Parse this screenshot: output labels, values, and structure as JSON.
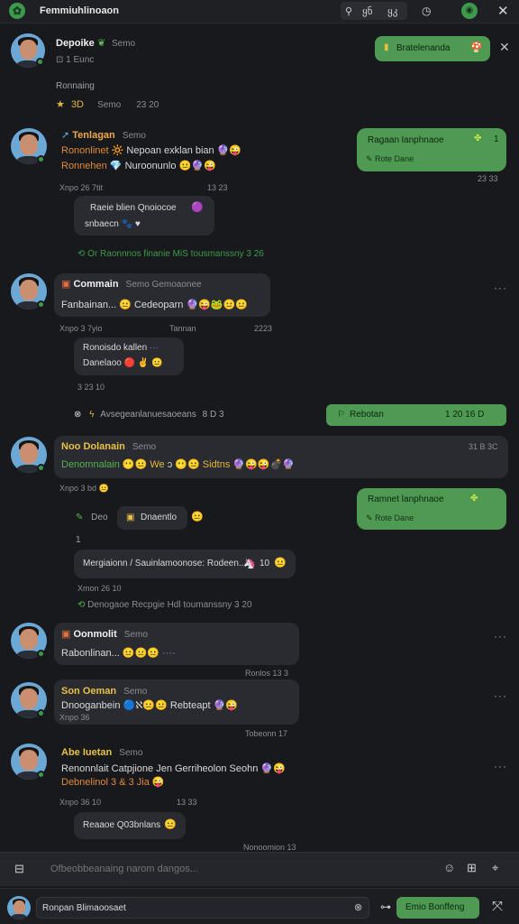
{
  "titlebar": {
    "title": "Femmiuhlinoaon",
    "control_a": "ყნ",
    "control_b": "ყკ",
    "control_c": "დ"
  },
  "contact": {
    "name": "Depoike",
    "status": "1 Eunc",
    "pinned_label": "Bratelenanda"
  },
  "section": {
    "title": "Ronnaing",
    "meta": "3D",
    "time": "23 20"
  },
  "messages": [
    {
      "sender": "Tenlagan",
      "sender_meta": "Semo",
      "line1": "Rononlinet",
      "line1b": "Nepoan exklan bian",
      "line2": "Ronnehen",
      "line2b": "Nuroonunlo",
      "meta_left": "Xnpo 26 7tit",
      "meta_right": "13 23"
    },
    {
      "reply_line1": "Raeie blien Qnoiocoe",
      "reply_line2": "snbaecn",
      "thread_link": "Or Raonnnos finanie MiS tousmanssny 3 26"
    },
    {
      "sender": "Commain",
      "sender_meta": "Semo Gemoaonee",
      "line1": "Fanbainan...",
      "line1b": "Cedeoparn",
      "meta_left": "Xnpo 3 7yio",
      "meta_center": "Tannan",
      "meta_right": "2223",
      "reply_line1": "Ronoisdo kallen",
      "reply_line2": "Danelaoo",
      "reply_time": "3 23 10"
    },
    {
      "sender": "Noo Dolanain",
      "sender_meta": "Semo",
      "line1": "Denomnalain",
      "line1b": "We",
      "line1c": "Sidtns",
      "meta_right": "31 B 3C",
      "meta_left": "Xnpo 3 bd",
      "chip": "Dnaentlo",
      "chip_lead": "Deo",
      "time_row": "1",
      "long_reply": "Mergiaionn / Sauinlamoonose: Rodeen...",
      "long_reply_tail": "10",
      "long_reply_meta": "Xmon 26 10",
      "thread_link": "Denogaoe Recpgie Hdl toumanssny 3 20"
    },
    {
      "sender": "Oonmolit",
      "sender_meta": "Semo",
      "line1": "Rabonlinan...",
      "time": "Ronlos 13 3"
    },
    {
      "sender": "Son Oeman",
      "sender_meta": "Semo",
      "line1": "Dnooganbein",
      "line1b": "Rebteapt",
      "meta_left": "Xnpo 36",
      "time": "Tobeonn 17"
    },
    {
      "sender": "Abe Iuetan",
      "sender_meta": "Semo",
      "line1": "Renonnlait",
      "line1b": "Catpjione",
      "line1c": "Jen Gerriheolon Seohn",
      "line2": "Debnelinol 3 & 3 Jia",
      "meta_left": "Xnpo 36 10",
      "meta_right": "13 33",
      "reply": "Reaaoe Q03bnlans",
      "time": "Nonoomion 13"
    }
  ],
  "outgoing": [
    {
      "title": "Ragaan lanphnaoe",
      "sub": "Rote Dane",
      "side": "1",
      "time": "23 33"
    },
    {
      "title": "Rebotan",
      "time": "1 20 16 D"
    },
    {
      "title": "Ramnet lanphnaoe",
      "sub": "Rote Dane"
    }
  ],
  "notice": {
    "text": "Avsegeanlanuesaoeans",
    "tail": "8 D 3"
  },
  "composer": {
    "placeholder": "Ofbeobbeanaing narom dangos..."
  },
  "bottom": {
    "input_value": "Ronpan Blimaoosaet",
    "send_label": "Emio Bonffeng"
  },
  "colors": {
    "accent_green": "#4e9a52",
    "background": "#18191c",
    "bubble": "#2a2b30"
  }
}
